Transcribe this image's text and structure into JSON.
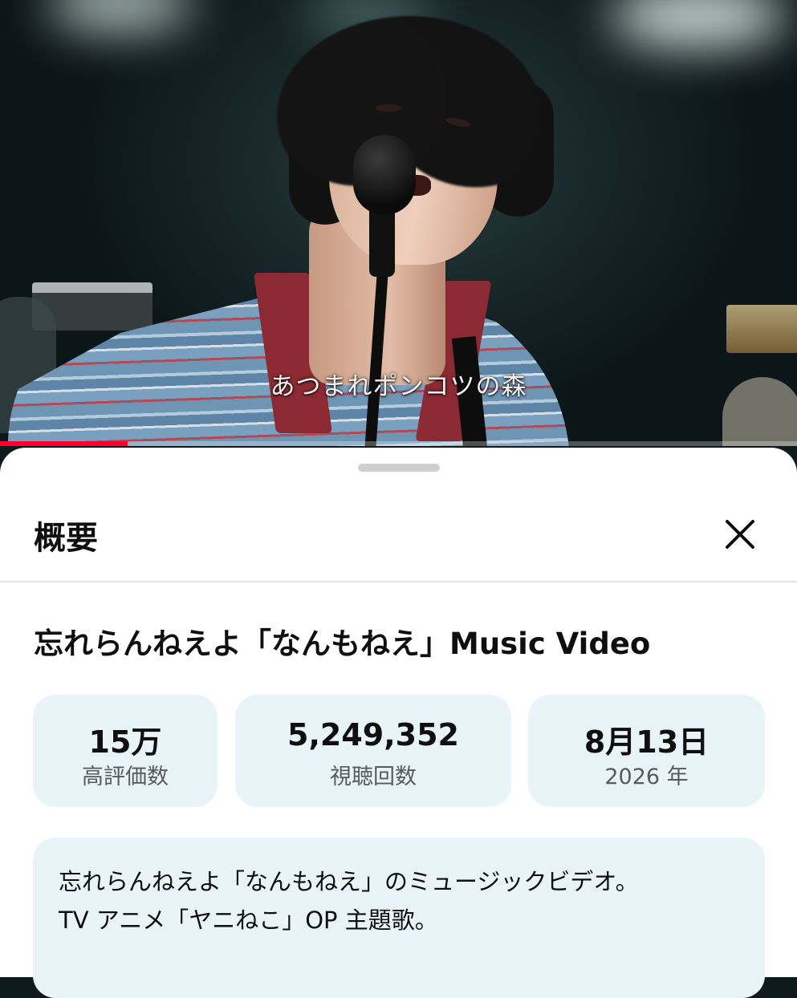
{
  "video": {
    "caption": "あつまれポンコツの森",
    "progress_fraction": 0.16
  },
  "sheet": {
    "title": "概要",
    "close_icon": "close-icon",
    "video_title": "忘れらんねえよ「なんもねえ」Music Video",
    "stats": {
      "likes": {
        "value": "15万",
        "label": "高評価数"
      },
      "views": {
        "value": "5,249,352",
        "label": "視聴回数"
      },
      "date": {
        "value": "8月13日",
        "label": "2026 年"
      }
    },
    "description": {
      "line1": "忘れらんねえよ「なんもねえ」のミュージックビデオ。",
      "line2": "TV アニメ「ヤニねこ」OP 主題歌。"
    }
  },
  "colors": {
    "accent": "#ff0033",
    "card_bg": "#e8f4f8",
    "text": "#0f0f0f",
    "subtext": "#555b5e"
  }
}
